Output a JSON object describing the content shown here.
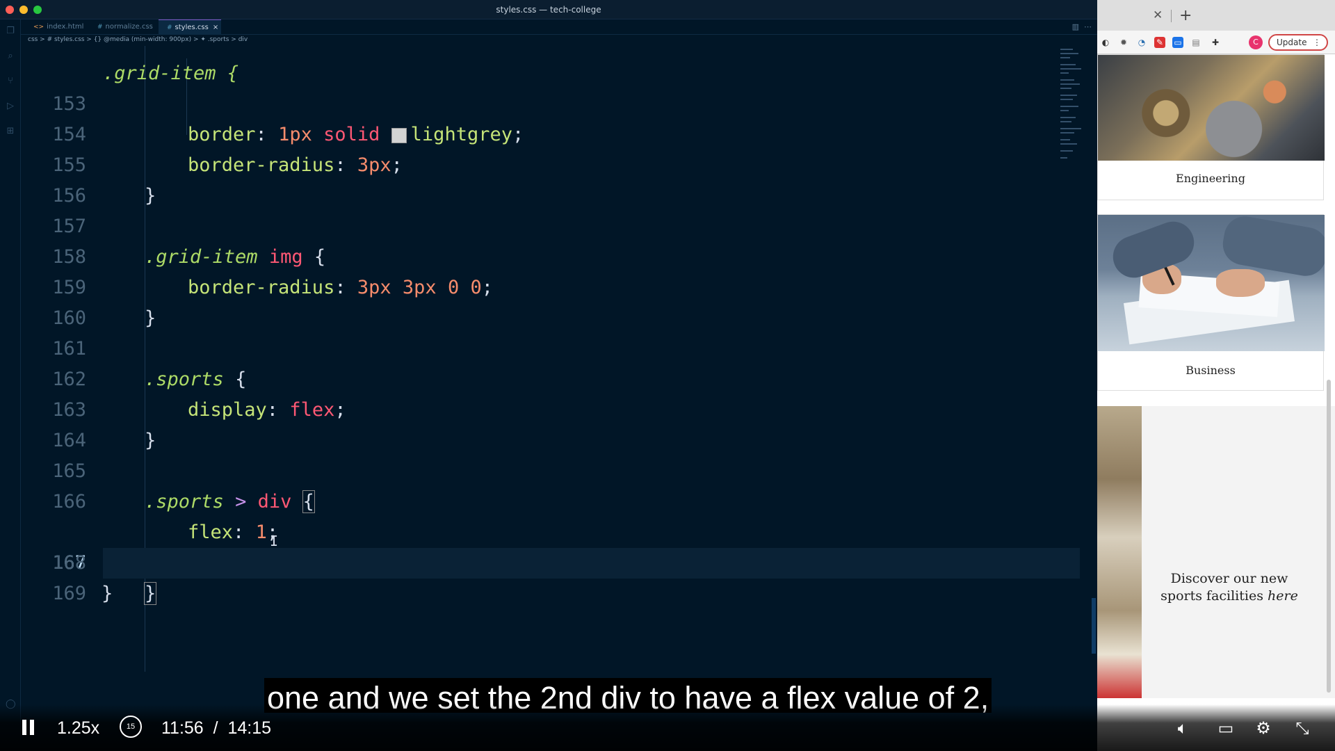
{
  "window": {
    "title": "styles.css — tech-college"
  },
  "tabs": [
    {
      "label": "index.html",
      "icon": "html-file-icon"
    },
    {
      "label": "normalize.css",
      "icon": "css-file-icon"
    },
    {
      "label": "styles.css",
      "icon": "css-file-icon",
      "active": true
    }
  ],
  "breadcrumb": "css > # styles.css > {} @media (min-width: 900px) > ✦ .sports > div",
  "code": {
    "partial_first_line": ".grid-item {",
    "lines": [
      {
        "n": "153"
      },
      {
        "n": "154"
      },
      {
        "n": "155"
      },
      {
        "n": "156"
      },
      {
        "n": "157"
      },
      {
        "n": "158"
      },
      {
        "n": "159"
      },
      {
        "n": "160"
      },
      {
        "n": "161"
      },
      {
        "n": "162"
      },
      {
        "n": "163"
      },
      {
        "n": "164"
      },
      {
        "n": "165"
      },
      {
        "n": "166"
      },
      {
        "n": "167",
        "current": true
      },
      {
        "n": "168"
      },
      {
        "n": "169"
      }
    ],
    "tokens": {
      "border": "border",
      "colon": ":",
      "semi": ";",
      "onepx": "1px",
      "solid": "solid",
      "lightgrey": "lightgrey",
      "border_radius": "border-radius",
      "threepx": "3px",
      "zero": "0",
      "close_brace": "}",
      "open_brace": "{",
      "grid_item": ".grid-item",
      "img": "img",
      "sports": ".sports",
      "display": "display",
      "flex_val": "flex",
      "gt": ">",
      "div": "div",
      "flex_prop": "flex",
      "one": "1"
    }
  },
  "browser": {
    "update_label": "Update",
    "avatar_letter": "C",
    "cards": [
      {
        "label": "Engineering"
      },
      {
        "label": "Business"
      }
    ],
    "promo": {
      "text_before": "Discover our new sports facilities ",
      "text_italic": "here"
    }
  },
  "video": {
    "subtitle": "one and we set the 2nd div to have a flex value of 2,",
    "speed": "1.25x",
    "rewind_seconds": "15",
    "current_time": "11:56",
    "separator": "/",
    "duration": "14:15"
  },
  "colors": {
    "editor_bg": "#011627",
    "selector": "#addb67",
    "tag": "#ff5874",
    "property": "#c5e478",
    "number": "#f78c6c",
    "swatch_lightgrey": "#d3d3d3"
  }
}
